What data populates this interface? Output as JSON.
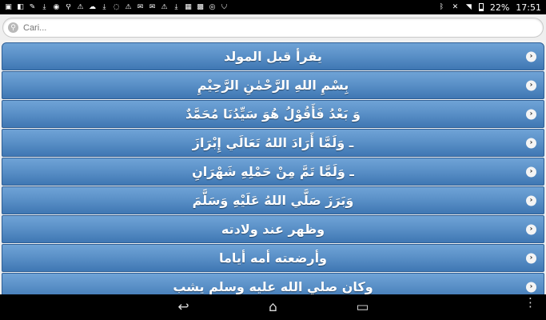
{
  "statusbar": {
    "left_icons": [
      "notif-a",
      "notif-b",
      "wrench",
      "download",
      "telegram",
      "pin",
      "warning",
      "cloud",
      "download-2",
      "ring",
      "warning-2",
      "chat",
      "chat-2",
      "warning-3",
      "download-3",
      "box",
      "photo",
      "instagram",
      "shield"
    ],
    "battery_text": "22%",
    "time": "17:51"
  },
  "search": {
    "placeholder": "Cari..."
  },
  "list": {
    "items": [
      {
        "label": "يقرأ قبل المولد"
      },
      {
        "label": "بِسْمِ اللهِ الرَّحْمٰنِ الرَّحِيْمِ"
      },
      {
        "label": "وَ بَعْدُ فَأَقُوْلُ هُوَ سَيِّدُنَا مُحَمَّدٌ"
      },
      {
        "label": "ـ وَلَمَّا أَرَادَ اللهُ تَعَالَي إِبْرَازَ"
      },
      {
        "label": "ـ وَلَمَّا تَمَّ مِنْ حَمْلِهِ شَهْرَانِ"
      },
      {
        "label": "وَبَرَزَ صَلَّي اللهُ عَلَيْهِ وَسَلَّمَ"
      },
      {
        "label": "وظهر عند ولادته"
      },
      {
        "label": "وأرضعته أمه أياما"
      },
      {
        "label": "وكان صلي الله عليه وسلم يشب"
      }
    ]
  },
  "navbar": {
    "back": "↩",
    "home": "⌂",
    "recent": "▭",
    "menu": "⋮"
  }
}
